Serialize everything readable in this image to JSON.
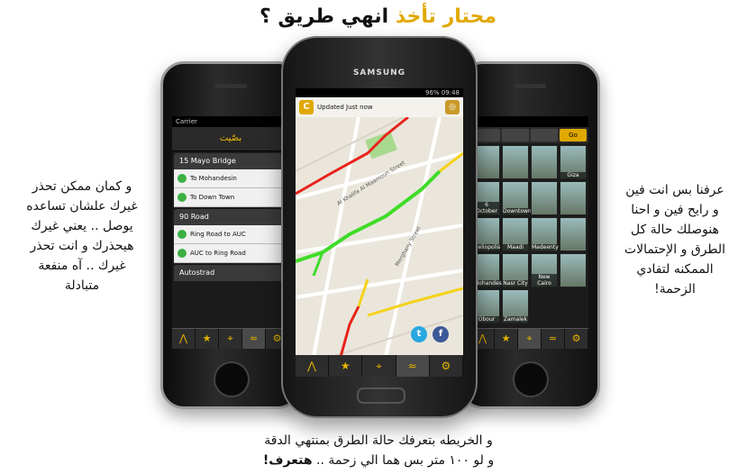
{
  "headline": {
    "accent": "محتار تأخذ",
    "rest": " انهي طريق ؟"
  },
  "left_caption": [
    "و كمان ممكن تحذر",
    "غيرك علشان تساعده",
    "يوصل .. يعني غيرك",
    "هيحذرك و انت تحذر",
    "غيرك .. آه منفعة",
    "متبادلة"
  ],
  "right_caption": [
    "عرفنا بس انت فين",
    "و رايح فين و احنا",
    "هنوصلك حالة كل",
    "الطرق و الإحتمالات",
    "الممكنه لتفادي",
    "الزحمة!"
  ],
  "bottom_caption": {
    "line1": "و الخريطه بتعرفك حالة الطرق بمنتهي الدقة",
    "line2": "و لو ١٠٠ متر بس هما  الي زحمة .. ",
    "line2_bold": "هتعرف!"
  },
  "left_phone": {
    "carrier": "Carrier",
    "app_logo": "بصّيت",
    "items": [
      {
        "type": "header",
        "label": "15 Mayo Bridge"
      },
      {
        "type": "item",
        "label": "To Mohandesin"
      },
      {
        "type": "item",
        "label": "To Down Town"
      },
      {
        "type": "header",
        "label": "90 Road"
      },
      {
        "type": "item",
        "label": "Ring Road to AUC"
      },
      {
        "type": "item",
        "label": "AUC to Ring Road"
      },
      {
        "type": "header",
        "label": "Autostrad"
      }
    ]
  },
  "center_phone": {
    "brand": "SAMSUNG",
    "status_time": "09:48",
    "status_battery": "96%",
    "update_text": "Updated Just now",
    "c_icon": "C",
    "streets": [
      "Al Khalifa Al Maamoun Street",
      "Merghany Street"
    ],
    "twitter": "t",
    "facebook": "f"
  },
  "right_phone": {
    "go_label": "Go",
    "cams": [
      "Giza",
      "6 October",
      "Downtown",
      "Heliopolis",
      "Maadi",
      "Madeenty",
      "Mohandesin",
      "Nasr City",
      "New Cairo",
      "Obour",
      "Zamalek"
    ]
  },
  "tab_icons": [
    "road-icon",
    "star-icon",
    "pin-icon",
    "traffic-icon",
    "gear-icon"
  ],
  "colors": {
    "accent": "#e0a800",
    "heavy": "#e8231b",
    "medium": "#f5d21a",
    "light": "#3fdc27"
  }
}
